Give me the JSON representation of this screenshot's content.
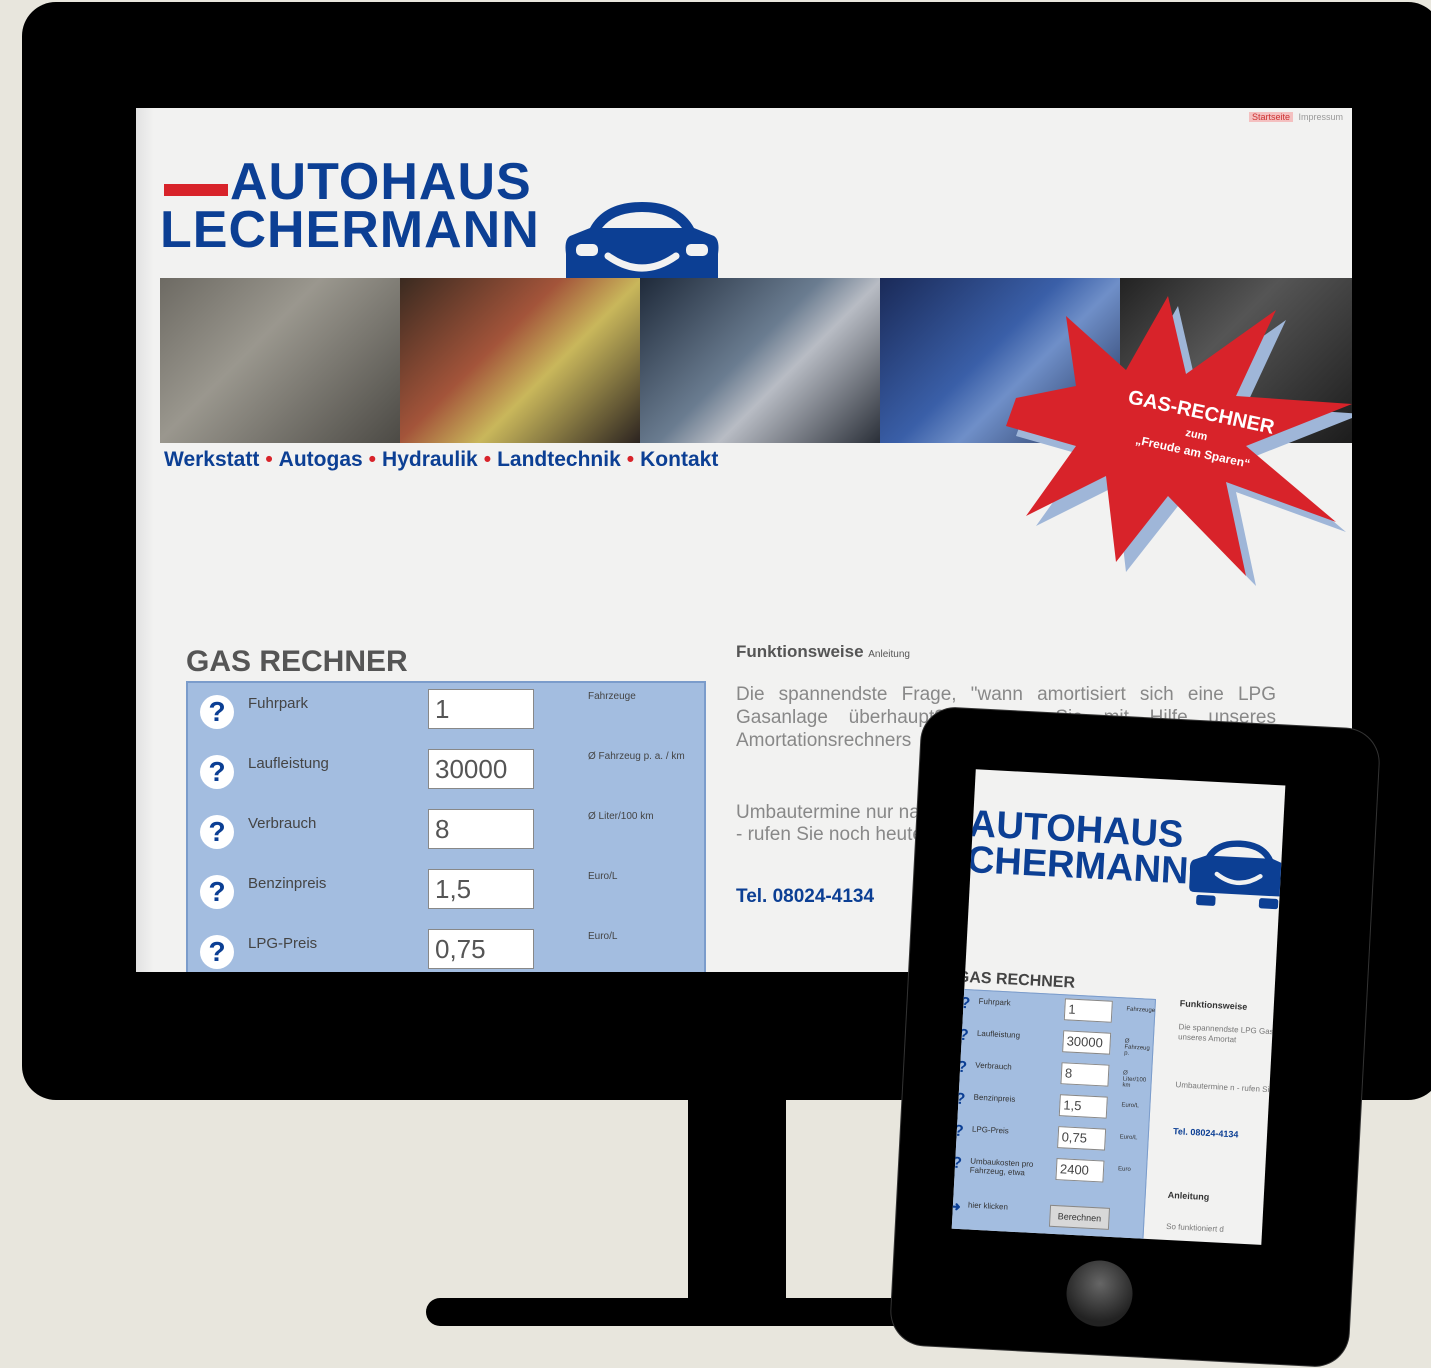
{
  "top_nav": [
    "Startseite",
    "Impressum"
  ],
  "logo": {
    "line1": "AUTOHAUS",
    "line2": "LECHERMANN"
  },
  "nav": [
    "Werkstatt",
    "Autogas",
    "Hydraulik",
    "Landtechnik",
    "Kontakt"
  ],
  "nav_separator": "•",
  "starburst": {
    "line1": "GAS-RECHNER",
    "line2": "zum",
    "line3": "„Freude am Sparen“"
  },
  "gas": {
    "title": "GAS RECHNER",
    "rows": [
      {
        "label": "Fuhrpark",
        "value": "1",
        "unit": "Fahrzeuge"
      },
      {
        "label": "Laufleistung",
        "value": "30000",
        "unit": "Ø Fahrzeug p. a. / km"
      },
      {
        "label": "Verbrauch",
        "value": "8",
        "unit": "Ø Liter/100 km"
      },
      {
        "label": "Benzinpreis",
        "value": "1,5",
        "unit": "Euro/L"
      },
      {
        "label": "LPG-Preis",
        "value": "0,75",
        "unit": "Euro/L"
      }
    ]
  },
  "funktion": {
    "title": "Funktionsweise",
    "link": "Anleitung",
    "text": "Die spannendste Frage, \"wann amortisiert sich eine LPG Gasanlage überhaupt?\" können Sie mit Hilfe unseres Amortationsrechners",
    "umbau_line1": "Umbautermine nur nach",
    "umbau_line2": "- rufen Sie noch heute",
    "tel": "Tel. 08024-4134"
  },
  "tablet": {
    "logo_line1": "AUTOHAUS",
    "logo_line2": "CHERMANN",
    "gas_title": "GAS RECHNER",
    "rows": [
      {
        "label": "Fuhrpark",
        "value": "1",
        "unit": "Fahrzeuge"
      },
      {
        "label": "Laufleistung",
        "value": "30000",
        "unit": "Ø Fahrzeug p."
      },
      {
        "label": "Verbrauch",
        "value": "8",
        "unit": "Ø Liter/100 km"
      },
      {
        "label": "Benzinpreis",
        "value": "1,5",
        "unit": "Euro/L"
      },
      {
        "label": "LPG-Preis",
        "value": "0,75",
        "unit": "Euro/L"
      },
      {
        "label": "Umbaukosten pro Fahrzeug, etwa",
        "value": "2400",
        "unit": "Euro"
      }
    ],
    "click_label": "hier klicken",
    "button": "Berechnen",
    "funk_title": "Funktionsweise",
    "funk_text": "Die spannendste LPG Gasanlage unseres Amortat",
    "umbau_text": "Umbautermine n - rufen Sie noch",
    "tel": "Tel. 08024-4134",
    "anleitung": "Anleitung",
    "so_text": "So funktioniert d"
  },
  "colors": {
    "brand_blue": "#0c3f94",
    "brand_red": "#d8232a",
    "calculator_bg": "#a3bde0"
  }
}
